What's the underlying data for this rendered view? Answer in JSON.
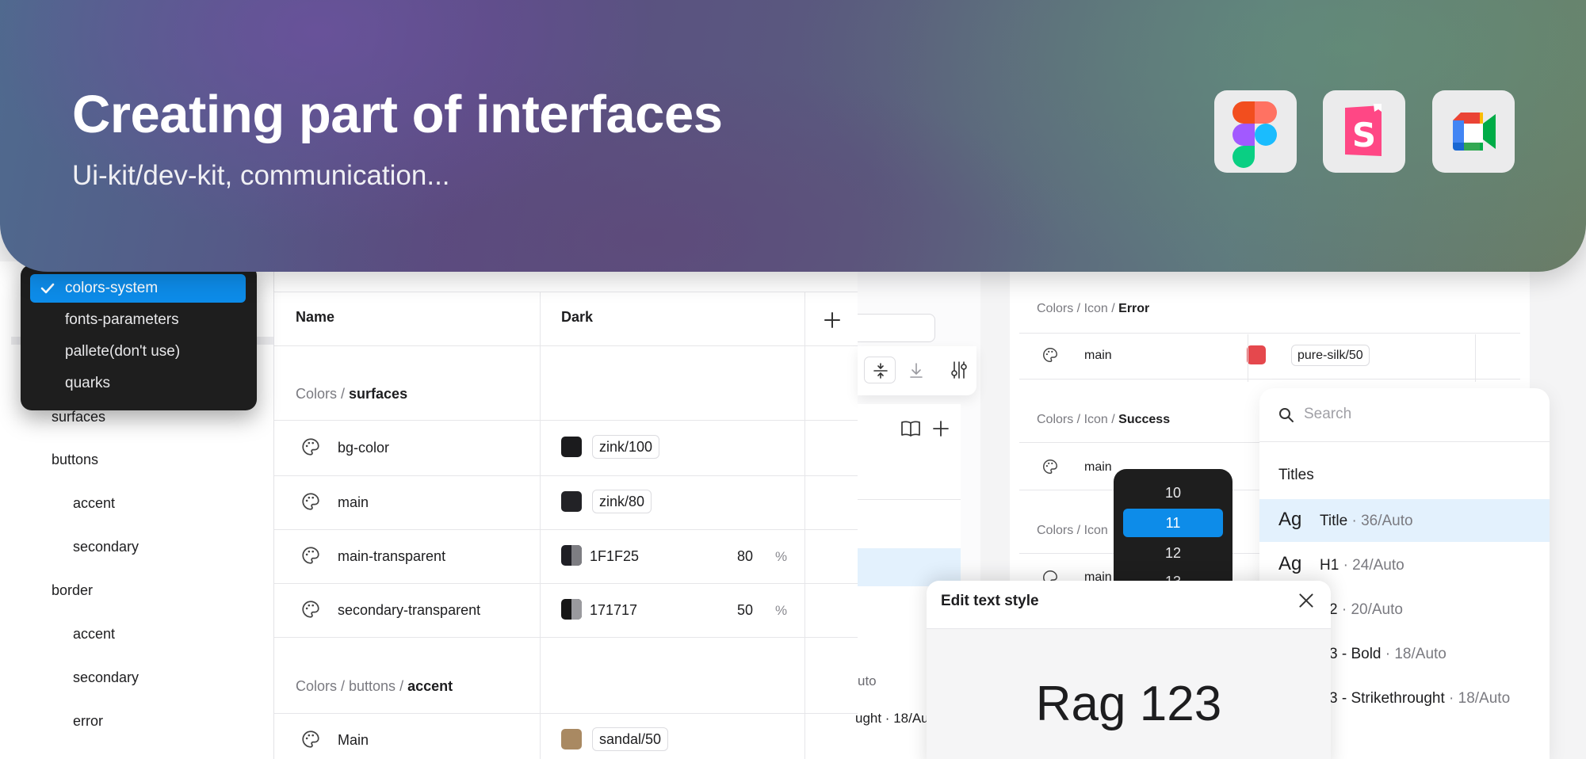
{
  "banner": {
    "title": "Creating part of interfaces",
    "subtitle": "Ui-kit/dev-kit, communication...",
    "apps": [
      "figma-logo",
      "storybook-logo",
      "google-meet-logo"
    ]
  },
  "dropdown": {
    "items": [
      "colors-system",
      "fonts-parameters",
      "pallete(don't use)",
      "quarks"
    ],
    "selected": "colors-system"
  },
  "sidebar": {
    "items": [
      "surfaces",
      "buttons",
      "accent",
      "secondary",
      "border",
      "accent",
      "secondary",
      "error"
    ]
  },
  "table": {
    "headers": {
      "name": "Name",
      "dark": "Dark",
      "add": "+"
    },
    "groups": [
      {
        "path": "Colors / ",
        "name": "surfaces"
      },
      {
        "path": "Colors / buttons / ",
        "name": "accent"
      }
    ],
    "rows": [
      {
        "name": "bg-color",
        "token": "zink/100",
        "color": "#1b1b1d"
      },
      {
        "name": "main",
        "token": "zink/80",
        "color": "#222226"
      },
      {
        "name": "main-transparent",
        "hex": "1F1F25",
        "opacity": "80",
        "color": "#1f1f25",
        "half": "#7d7d82"
      },
      {
        "name": "secondary-transparent",
        "hex": "171717",
        "opacity": "50",
        "color": "#171717",
        "half": "#9a9a9e"
      },
      {
        "name": "Main",
        "token": "sandal/50",
        "color": "#a98962"
      }
    ],
    "pct_sign": "%"
  },
  "fragments": {
    "uto": "uto",
    "ught": "ught · 18/Au"
  },
  "rtable": {
    "sections": [
      {
        "path": "Colors / Icon / ",
        "name": "Error",
        "row": "main",
        "token": "pure-silk/50",
        "color": "#e5484d"
      },
      {
        "path": "Colors / Icon / ",
        "name": "Success",
        "row": "main"
      },
      {
        "path": "Colors / Icon",
        "row": "main"
      }
    ]
  },
  "numpick": {
    "values": [
      "10",
      "11",
      "12",
      "13"
    ],
    "selected": "11"
  },
  "stylelist": {
    "placeholder": "Search",
    "heading": "Titles",
    "rows": [
      {
        "ag": "Ag",
        "name": "Title",
        "meta": " · 36/Auto"
      },
      {
        "ag": "Ag",
        "name": "H1",
        "meta": " · 24/Auto"
      },
      {
        "ag": "",
        "name": "2",
        "meta": " · 20/Auto"
      },
      {
        "ag": "",
        "name": "3 - Bold",
        "meta": " · 18/Auto"
      },
      {
        "ag": "",
        "name": "3 - Strikethrought",
        "meta": " · 18/Auto"
      }
    ]
  },
  "modal": {
    "title": "Edit text style",
    "preview": "Rag 123"
  }
}
